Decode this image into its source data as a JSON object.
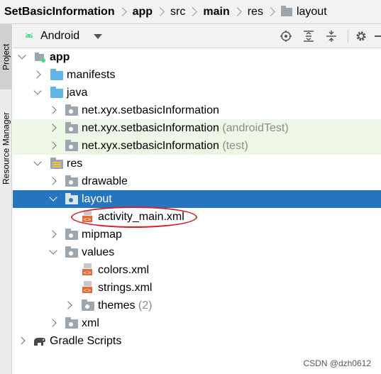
{
  "breadcrumb": {
    "items": [
      {
        "label": "SetBasicInformation",
        "bold": true
      },
      {
        "label": "app",
        "bold": true
      },
      {
        "label": "src",
        "bold": false
      },
      {
        "label": "main",
        "bold": true
      },
      {
        "label": "res",
        "bold": false
      },
      {
        "label": "layout",
        "bold": false,
        "icon": "folder-icon"
      }
    ]
  },
  "tool_strip": {
    "project_tab": "Project",
    "resource_manager_tab": "Resource Manager"
  },
  "panel_header": {
    "view_selector": "Android",
    "icons": [
      "locate-icon",
      "expand-all-icon",
      "collapse-all-icon",
      "settings-icon",
      "hide-icon"
    ]
  },
  "tree": {
    "app": "app",
    "manifests": "manifests",
    "java": "java",
    "pkg_main": "net.xyx.setbasicInformation",
    "pkg_android_test": "net.xyx.setbasicInformation",
    "pkg_android_test_suffix": "(androidTest)",
    "pkg_test": "net.xyx.setbasicInformation",
    "pkg_test_suffix": "(test)",
    "res": "res",
    "drawable": "drawable",
    "layout": "layout",
    "activity_main": "activity_main.xml",
    "mipmap": "mipmap",
    "values": "values",
    "colors": "colors.xml",
    "strings": "strings.xml",
    "themes": "themes",
    "themes_count": "(2)",
    "xml": "xml",
    "gradle_scripts": "Gradle Scripts"
  },
  "watermark": "CSDN @dzh0612",
  "colors": {
    "selection": "#2675bf",
    "test_highlight": "#eef6e6",
    "annotation": "#d6202a"
  }
}
